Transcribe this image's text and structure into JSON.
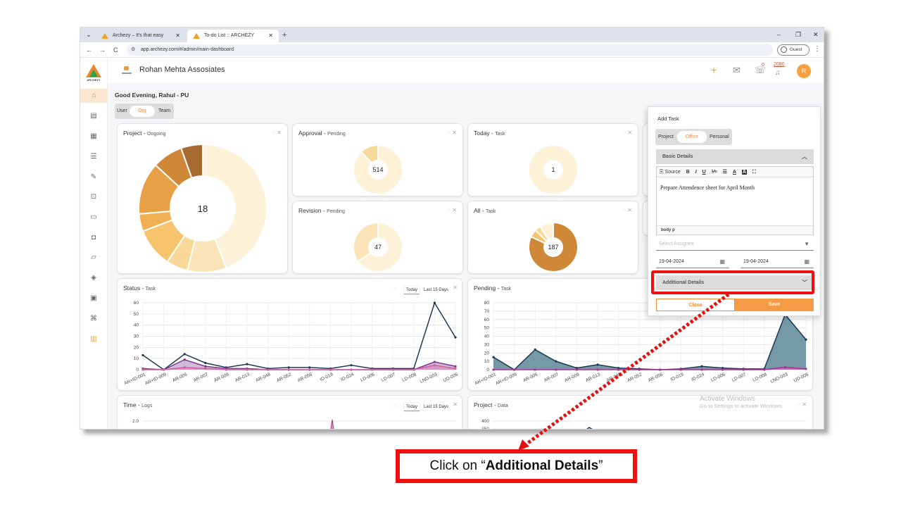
{
  "browser": {
    "tabs": [
      {
        "title": "Archezy – It's that easy",
        "close": "✕"
      },
      {
        "title": "To-do List :: ARCHEZY",
        "close": "✕"
      }
    ],
    "tabs_menu": "⌄",
    "new_tab": "+",
    "window_controls": {
      "minimize": "–",
      "restore": "❐",
      "close": "✕"
    },
    "nav": {
      "back": "←",
      "forward": "→",
      "reload": "C"
    },
    "url": "app.archezy.com/#/admin/main-dashboard",
    "site_settings": "⚙",
    "profile": "Guest",
    "menu": "⋮"
  },
  "sidebar": {
    "brand": "ARCHEZY",
    "icons": [
      "home-icon",
      "document-icon",
      "clipboard-icon",
      "list-icon",
      "edit-icon",
      "bookmark-icon",
      "book-icon",
      "bag-icon",
      "folder-icon",
      "shield-icon",
      "report-icon",
      "network-icon",
      "building-icon"
    ]
  },
  "topbar": {
    "org_name": "Rohan Mehta Assosiates",
    "notif_count": "0",
    "points": "2080",
    "avatar": "R"
  },
  "greeting": "Good Evening, Rahul - PU",
  "view_toggle": {
    "options": [
      "User",
      "Org",
      "Team"
    ],
    "selected": "Org"
  },
  "cards": {
    "project": {
      "title": "Project - ",
      "subtitle": "Ongoing",
      "center": "18"
    },
    "approval": {
      "title": "Approval - ",
      "subtitle": "Pending",
      "center": "514"
    },
    "today": {
      "title": "Today - ",
      "subtitle": "Task",
      "center": "1"
    },
    "revision": {
      "title": "Revision - ",
      "subtitle": "Pending",
      "center": "47"
    },
    "all": {
      "title": "All - ",
      "subtitle": "Task",
      "center": "187"
    },
    "status": {
      "title": "Status - ",
      "subtitle": "Task",
      "btn_today": "Today",
      "btn_last": "Last 15 Days"
    },
    "pending": {
      "title": "Pending - ",
      "subtitle": "Task"
    },
    "time": {
      "title": "Time - ",
      "subtitle": "Logs",
      "btn_today": "Today",
      "btn_last": "Last 15 Days"
    },
    "project_data": {
      "title": "Project - ",
      "subtitle": "Data"
    }
  },
  "chart_data": [
    {
      "type": "pie",
      "title": "Project - Ongoing",
      "center_label": "18",
      "values": [
        40,
        9,
        5,
        9,
        4,
        12,
        7,
        5
      ],
      "colors": [
        "#fdf1d8",
        "#fbe5b8",
        "#f9d99a",
        "#f5c46d",
        "#f0b052",
        "#e6a045",
        "#cf8838",
        "#a76a30"
      ]
    },
    {
      "type": "pie",
      "title": "Approval - Pending",
      "center_label": "514",
      "values": [
        88,
        12
      ],
      "colors": [
        "#fdf1d8",
        "#f9d99a"
      ]
    },
    {
      "type": "pie",
      "title": "Today - Task",
      "center_label": "1",
      "values": [
        100
      ],
      "colors": [
        "#fdf1d8"
      ]
    },
    {
      "type": "pie",
      "title": "Revision - Pending",
      "center_label": "47",
      "values": [
        65,
        35
      ],
      "colors": [
        "#fdf1d8",
        "#fbe5b8"
      ]
    },
    {
      "type": "pie",
      "title": "All - Task",
      "center_label": "187",
      "values": [
        82,
        5,
        4,
        9
      ],
      "colors": [
        "#cf8838",
        "#f5c46d",
        "#f9d99a",
        "#fdf1d8"
      ]
    },
    {
      "type": "line",
      "title": "Status - Task",
      "categories": [
        "AR+ID-001",
        "AR+ID-009",
        "AR-005",
        "AR-007",
        "AR-009",
        "AR-013",
        "AR-048",
        "AR-052",
        "AR-056",
        "ID-019",
        "ID-024",
        "LD-006",
        "LD-007",
        "LD-008",
        "LND-003",
        "UD-005"
      ],
      "ylim": [
        0,
        60
      ],
      "yticks": [
        0,
        10,
        20,
        30,
        40,
        50,
        60
      ],
      "series": [
        {
          "values": [
            13,
            0,
            14,
            6,
            2,
            5,
            1,
            2,
            2,
            1,
            4,
            1,
            1,
            1,
            60,
            29
          ],
          "color": "#1b3a52"
        },
        {
          "values": [
            1,
            0,
            9,
            3,
            1,
            1,
            0,
            0,
            0,
            0,
            0,
            0,
            0,
            0,
            7,
            3
          ],
          "color": "#7a3a8c"
        },
        {
          "values": [
            0,
            0,
            2,
            1,
            0,
            0,
            0,
            0,
            0,
            0,
            0,
            0,
            0,
            0,
            4,
            1
          ],
          "color": "#d060a0"
        }
      ]
    },
    {
      "type": "area",
      "title": "Pending - Task",
      "categories": [
        "AR+ID-001",
        "AR+ID-009",
        "AR-005",
        "AR-007",
        "AR-009",
        "AR-013",
        "AR-048",
        "AR-052",
        "AR-056",
        "ID-019",
        "ID-024",
        "LD-006",
        "LD-007",
        "LD-008",
        "LND-003",
        "UD-005"
      ],
      "ylim": [
        0,
        80
      ],
      "yticks": [
        0,
        10,
        20,
        30,
        40,
        50,
        60,
        70,
        80
      ],
      "series": [
        {
          "values": [
            15,
            0,
            24,
            10,
            2,
            6,
            2,
            1,
            0,
            1,
            4,
            2,
            1,
            1,
            66,
            36
          ],
          "color": "#1b3a52"
        },
        {
          "values": [
            0,
            0,
            0,
            0,
            0,
            0,
            0,
            0,
            0,
            0,
            0,
            0,
            0,
            0,
            3,
            1
          ],
          "color": "#b03090"
        }
      ]
    },
    {
      "type": "line",
      "title": "Time - Logs",
      "yticks": [
        2.0
      ]
    },
    {
      "type": "line",
      "title": "Project - Data",
      "yticks": [
        400,
        350
      ]
    }
  ],
  "add_task": {
    "title": "Add Task",
    "tabs": [
      "Project",
      "Office",
      "Personal"
    ],
    "selected_tab": "Office",
    "basic_details": "Basic Details",
    "toolbar": {
      "source": "Source",
      "bold": "B",
      "italic": "I",
      "underline": "U",
      "ol": "⅟≡",
      "ul": "☰",
      "color": "A",
      "bg": "A",
      "max": "⛶"
    },
    "body_text": "Prepare Attendence sheet for April Month",
    "path": "body  p",
    "assignee_placeholder": "Select Assignee",
    "start_date": "19-04-2024",
    "end_date": "19-04-2024",
    "additional_details": "Additional Details",
    "close": "Close",
    "save": "Save"
  },
  "watermark": {
    "title": "Activate Windows",
    "sub": "Go to Settings to activate Windows."
  },
  "callout": {
    "prefix": "Click on “",
    "bold": "Additional Details",
    "suffix": "”"
  }
}
